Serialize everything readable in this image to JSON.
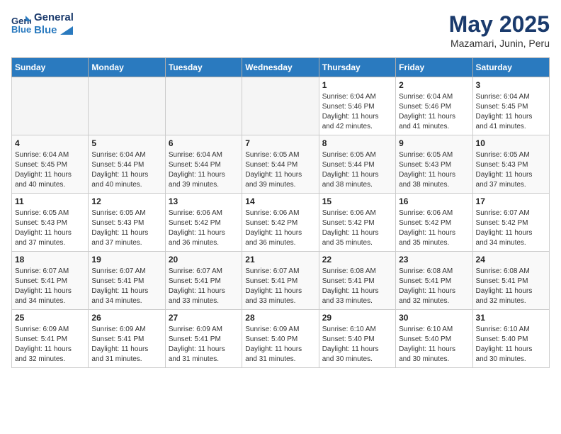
{
  "header": {
    "logo_line1": "General",
    "logo_line2": "Blue",
    "main_title": "May 2025",
    "subtitle": "Mazamari, Junin, Peru"
  },
  "days_of_week": [
    "Sunday",
    "Monday",
    "Tuesday",
    "Wednesday",
    "Thursday",
    "Friday",
    "Saturday"
  ],
  "weeks": [
    [
      {
        "day": "",
        "info": ""
      },
      {
        "day": "",
        "info": ""
      },
      {
        "day": "",
        "info": ""
      },
      {
        "day": "",
        "info": ""
      },
      {
        "day": "1",
        "info": "Sunrise: 6:04 AM\nSunset: 5:46 PM\nDaylight: 11 hours\nand 42 minutes."
      },
      {
        "day": "2",
        "info": "Sunrise: 6:04 AM\nSunset: 5:46 PM\nDaylight: 11 hours\nand 41 minutes."
      },
      {
        "day": "3",
        "info": "Sunrise: 6:04 AM\nSunset: 5:45 PM\nDaylight: 11 hours\nand 41 minutes."
      }
    ],
    [
      {
        "day": "4",
        "info": "Sunrise: 6:04 AM\nSunset: 5:45 PM\nDaylight: 11 hours\nand 40 minutes."
      },
      {
        "day": "5",
        "info": "Sunrise: 6:04 AM\nSunset: 5:44 PM\nDaylight: 11 hours\nand 40 minutes."
      },
      {
        "day": "6",
        "info": "Sunrise: 6:04 AM\nSunset: 5:44 PM\nDaylight: 11 hours\nand 39 minutes."
      },
      {
        "day": "7",
        "info": "Sunrise: 6:05 AM\nSunset: 5:44 PM\nDaylight: 11 hours\nand 39 minutes."
      },
      {
        "day": "8",
        "info": "Sunrise: 6:05 AM\nSunset: 5:44 PM\nDaylight: 11 hours\nand 38 minutes."
      },
      {
        "day": "9",
        "info": "Sunrise: 6:05 AM\nSunset: 5:43 PM\nDaylight: 11 hours\nand 38 minutes."
      },
      {
        "day": "10",
        "info": "Sunrise: 6:05 AM\nSunset: 5:43 PM\nDaylight: 11 hours\nand 37 minutes."
      }
    ],
    [
      {
        "day": "11",
        "info": "Sunrise: 6:05 AM\nSunset: 5:43 PM\nDaylight: 11 hours\nand 37 minutes."
      },
      {
        "day": "12",
        "info": "Sunrise: 6:05 AM\nSunset: 5:43 PM\nDaylight: 11 hours\nand 37 minutes."
      },
      {
        "day": "13",
        "info": "Sunrise: 6:06 AM\nSunset: 5:42 PM\nDaylight: 11 hours\nand 36 minutes."
      },
      {
        "day": "14",
        "info": "Sunrise: 6:06 AM\nSunset: 5:42 PM\nDaylight: 11 hours\nand 36 minutes."
      },
      {
        "day": "15",
        "info": "Sunrise: 6:06 AM\nSunset: 5:42 PM\nDaylight: 11 hours\nand 35 minutes."
      },
      {
        "day": "16",
        "info": "Sunrise: 6:06 AM\nSunset: 5:42 PM\nDaylight: 11 hours\nand 35 minutes."
      },
      {
        "day": "17",
        "info": "Sunrise: 6:07 AM\nSunset: 5:42 PM\nDaylight: 11 hours\nand 34 minutes."
      }
    ],
    [
      {
        "day": "18",
        "info": "Sunrise: 6:07 AM\nSunset: 5:41 PM\nDaylight: 11 hours\nand 34 minutes."
      },
      {
        "day": "19",
        "info": "Sunrise: 6:07 AM\nSunset: 5:41 PM\nDaylight: 11 hours\nand 34 minutes."
      },
      {
        "day": "20",
        "info": "Sunrise: 6:07 AM\nSunset: 5:41 PM\nDaylight: 11 hours\nand 33 minutes."
      },
      {
        "day": "21",
        "info": "Sunrise: 6:07 AM\nSunset: 5:41 PM\nDaylight: 11 hours\nand 33 minutes."
      },
      {
        "day": "22",
        "info": "Sunrise: 6:08 AM\nSunset: 5:41 PM\nDaylight: 11 hours\nand 33 minutes."
      },
      {
        "day": "23",
        "info": "Sunrise: 6:08 AM\nSunset: 5:41 PM\nDaylight: 11 hours\nand 32 minutes."
      },
      {
        "day": "24",
        "info": "Sunrise: 6:08 AM\nSunset: 5:41 PM\nDaylight: 11 hours\nand 32 minutes."
      }
    ],
    [
      {
        "day": "25",
        "info": "Sunrise: 6:09 AM\nSunset: 5:41 PM\nDaylight: 11 hours\nand 32 minutes."
      },
      {
        "day": "26",
        "info": "Sunrise: 6:09 AM\nSunset: 5:41 PM\nDaylight: 11 hours\nand 31 minutes."
      },
      {
        "day": "27",
        "info": "Sunrise: 6:09 AM\nSunset: 5:41 PM\nDaylight: 11 hours\nand 31 minutes."
      },
      {
        "day": "28",
        "info": "Sunrise: 6:09 AM\nSunset: 5:40 PM\nDaylight: 11 hours\nand 31 minutes."
      },
      {
        "day": "29",
        "info": "Sunrise: 6:10 AM\nSunset: 5:40 PM\nDaylight: 11 hours\nand 30 minutes."
      },
      {
        "day": "30",
        "info": "Sunrise: 6:10 AM\nSunset: 5:40 PM\nDaylight: 11 hours\nand 30 minutes."
      },
      {
        "day": "31",
        "info": "Sunrise: 6:10 AM\nSunset: 5:40 PM\nDaylight: 11 hours\nand 30 minutes."
      }
    ]
  ]
}
